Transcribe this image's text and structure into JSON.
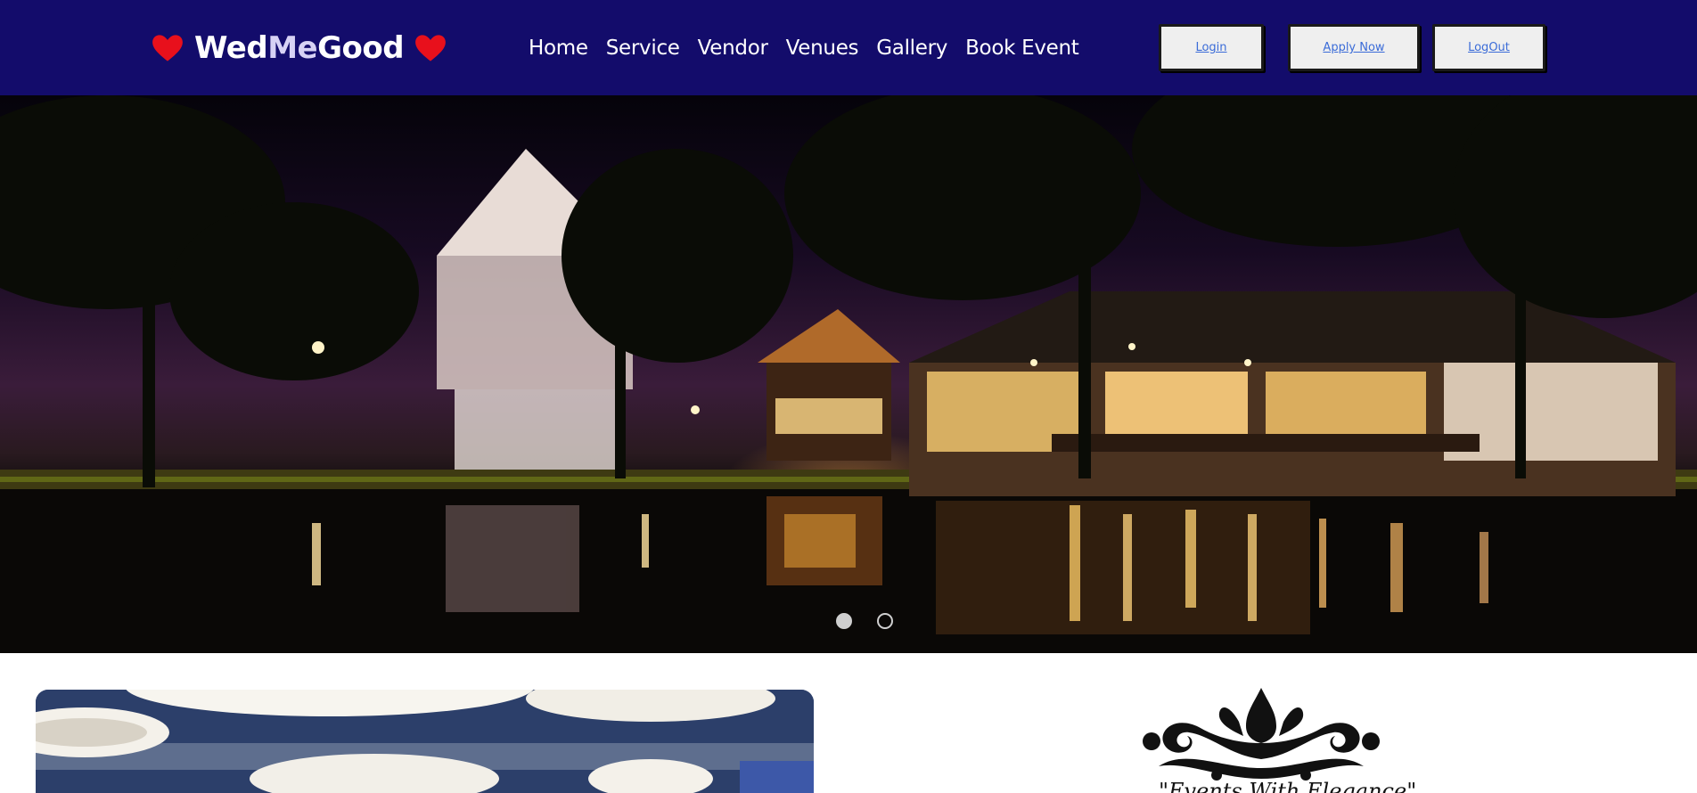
{
  "header": {
    "brand": {
      "part1": "Wed",
      "part2": "Me",
      "part3": "Good"
    },
    "nav": [
      "Home",
      "Service",
      "Vendor",
      "Venues",
      "Gallery",
      "Book Event"
    ],
    "buttons": {
      "login": "Login",
      "apply": "Apply Now",
      "logout": "LogOut"
    }
  },
  "hero": {
    "slides_total": 2,
    "active_slide": 1
  },
  "section": {
    "tagline": "\"Events With Elegance\""
  },
  "colors": {
    "header_bg": "#130c6b",
    "heart": "#e8101c",
    "button_link": "#3b6cd8"
  },
  "icons": [
    "heart-icon",
    "ornament-icon"
  ]
}
